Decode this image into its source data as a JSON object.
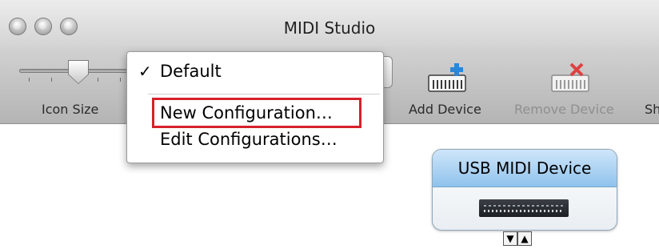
{
  "window": {
    "title": "MIDI Studio"
  },
  "toolbar": {
    "icon_size_label": "Icon Size",
    "add_device_label": "Add Device",
    "remove_device_label": "Remove Device",
    "truncated_label": "Sh"
  },
  "config_menu": {
    "items": [
      {
        "label": "Default",
        "checked": true,
        "check_glyph": "✓"
      },
      {
        "label": "New Configuration…",
        "highlighted": true
      },
      {
        "label": "Edit Configurations…"
      }
    ]
  },
  "device": {
    "name": "USB MIDI Device",
    "ports": [
      "▼",
      "▲"
    ]
  },
  "colors": {
    "highlight_border": "#d5212b",
    "device_header": "#8fc2ec",
    "add_icon": "#2b86d9",
    "remove_icon": "#e04040"
  }
}
